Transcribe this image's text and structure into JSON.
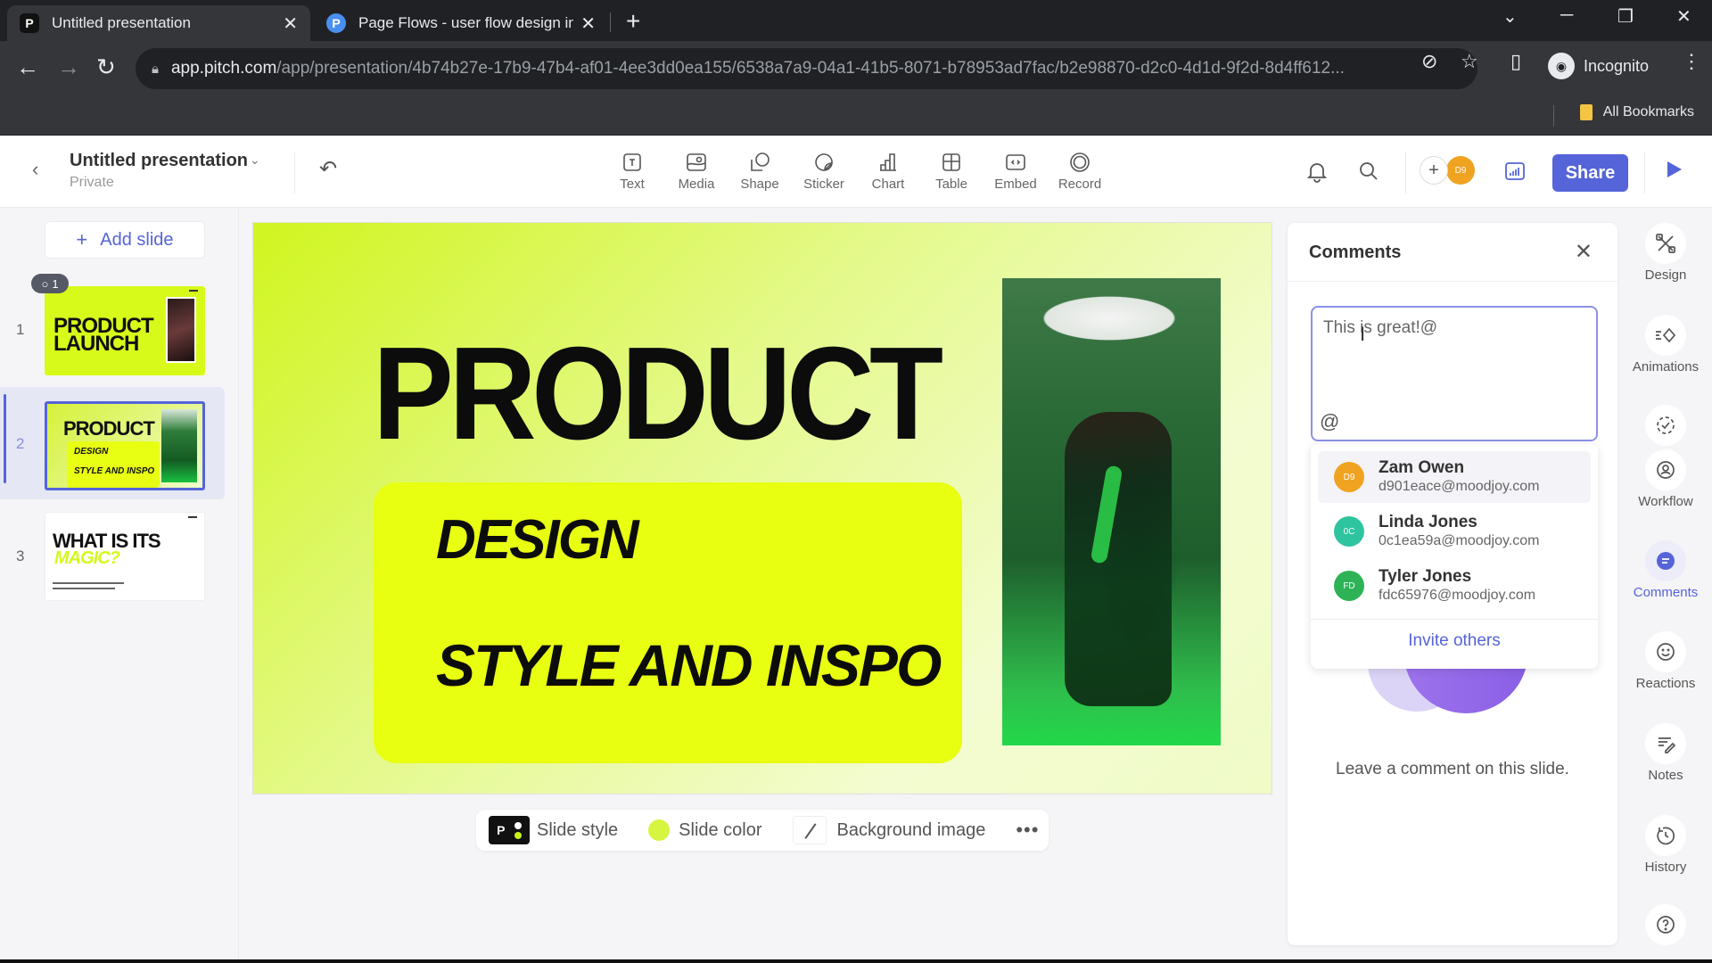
{
  "browser": {
    "tabs": [
      {
        "title": "Untitled presentation",
        "active": true,
        "favicon": "pitch-logo-icon"
      },
      {
        "title": "Page Flows - user flow design in",
        "active": false,
        "favicon": "pageflows-logo-icon"
      }
    ],
    "url_host": "app.pitch.com",
    "url_path": "/app/presentation/4b74b27e-17b9-47b4-af01-4ee3dd0ea155/6538a7a9-04a1-41b5-8071-b78953ad7fac/b2e98870-d2c0-4d1d-9f2d-8d4ff612...",
    "profile_label": "Incognito",
    "bookmarks_label": "All Bookmarks"
  },
  "app": {
    "doc_title": "Untitled presentation",
    "doc_visibility": "Private",
    "tools": [
      {
        "label": "Text",
        "icon": "text-icon"
      },
      {
        "label": "Media",
        "icon": "media-icon"
      },
      {
        "label": "Shape",
        "icon": "shape-icon"
      },
      {
        "label": "Sticker",
        "icon": "sticker-icon"
      },
      {
        "label": "Chart",
        "icon": "chart-icon"
      },
      {
        "label": "Table",
        "icon": "table-icon"
      },
      {
        "label": "Embed",
        "icon": "embed-icon"
      },
      {
        "label": "Record",
        "icon": "record-icon"
      }
    ],
    "collaborator_initials": "D9",
    "share_label": "Share",
    "accent_color": "#5564d8"
  },
  "slides_panel": {
    "add_slide_label": "Add slide",
    "slides": [
      {
        "number": "1",
        "title_line1": "PRODUCT",
        "title_line2": "LAUNCH",
        "comment_count": "1"
      },
      {
        "number": "2",
        "title": "PRODUCT",
        "line1": "DESIGN",
        "line2": "STYLE AND INSPO",
        "selected": true
      },
      {
        "number": "3",
        "title": "WHAT IS ITS",
        "subtitle": "MAGIC?"
      }
    ]
  },
  "slide": {
    "title": "PRODUCT",
    "line1": "DESIGN",
    "line2": "STYLE AND INSPO",
    "background_color": "#d0f51f",
    "box_color": "#e9ff12"
  },
  "slide_toolbar": {
    "style_label": "Slide style",
    "color_label": "Slide color",
    "bg_image_label": "Background image",
    "more_label": "•••"
  },
  "comments": {
    "title": "Comments",
    "input_value": "This is great!@",
    "mention_symbol": "@",
    "mentions": [
      {
        "name": "Zam Owen",
        "email": "d901eace@moodjoy.com",
        "initials": "D9",
        "color": "#f0a321"
      },
      {
        "name": "Linda Jones",
        "email": "0c1ea59a@moodjoy.com",
        "initials": "0C",
        "color": "#2ec4a0"
      },
      {
        "name": "Tyler Jones",
        "email": "fdc65976@moodjoy.com",
        "initials": "FD",
        "color": "#2db356"
      }
    ],
    "invite_label": "Invite others",
    "empty_text": "Leave a comment on this slide."
  },
  "rail": {
    "items": [
      {
        "label": "Design"
      },
      {
        "label": "Animations"
      },
      {
        "label": "Workflow"
      },
      {
        "label": "Comments"
      },
      {
        "label": "Reactions"
      },
      {
        "label": "Notes"
      },
      {
        "label": "History"
      }
    ]
  }
}
